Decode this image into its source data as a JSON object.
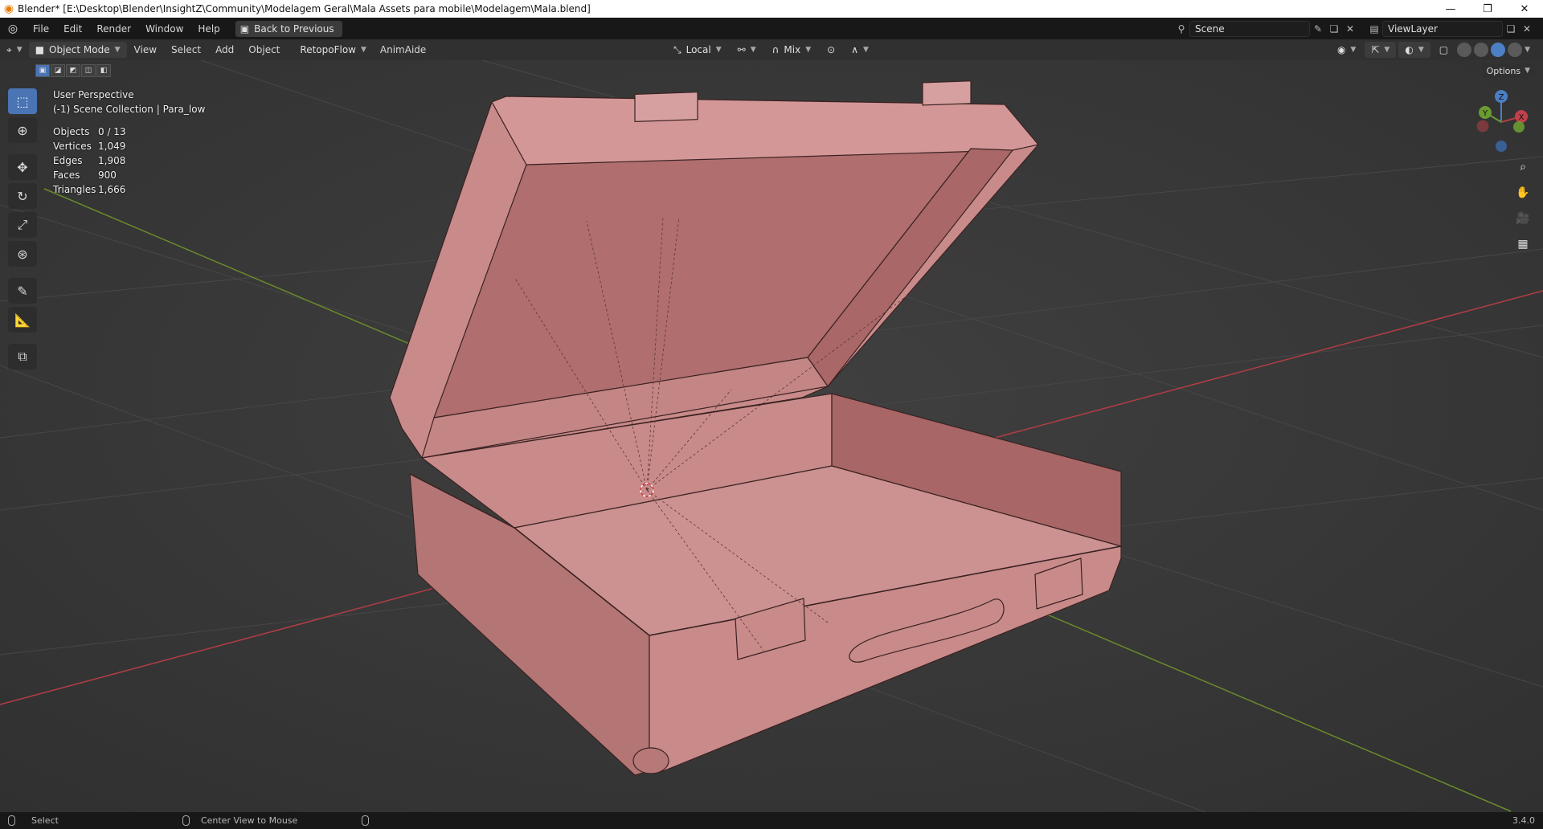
{
  "titlebar": {
    "title": "Blender* [E:\\Desktop\\Blender\\InsightZ\\Community\\Modelagem Geral\\Mala Assets para mobile\\Modelagem\\Mala.blend]",
    "minimize": "—",
    "restore": "❐",
    "close": "✕"
  },
  "menu": {
    "items": [
      "File",
      "Edit",
      "Render",
      "Window",
      "Help"
    ],
    "back_label": "Back to Previous"
  },
  "scene": {
    "scene_name": "Scene",
    "view_layer": "ViewLayer"
  },
  "viewport_header": {
    "mode": "Object Mode",
    "menus": [
      "View",
      "Select",
      "Add",
      "Object"
    ],
    "addons": [
      "RetopoFlow",
      "AnimAide"
    ],
    "transform_orientation": "Local",
    "snap_mix": "Mix",
    "options_label": "Options"
  },
  "overlay": {
    "view_name": "User Perspective",
    "collection": "(-1) Scene Collection | Para_low",
    "stats": [
      {
        "label": "Objects",
        "value": "0 / 13"
      },
      {
        "label": "Vertices",
        "value": "1,049"
      },
      {
        "label": "Edges",
        "value": "1,908"
      },
      {
        "label": "Faces",
        "value": "900"
      },
      {
        "label": "Triangles",
        "value": "1,666"
      }
    ]
  },
  "gizmo": {
    "x": "X",
    "y": "Y",
    "z": "Z"
  },
  "statusbar": {
    "select": "Select",
    "center_view": "Center View to Mouse",
    "version": "3.4.0"
  },
  "colors": {
    "accent": "#4a74b4",
    "suitcase_face": "#c98a8a",
    "x_axis": "#b33d45",
    "y_axis": "#6a8a2a"
  }
}
